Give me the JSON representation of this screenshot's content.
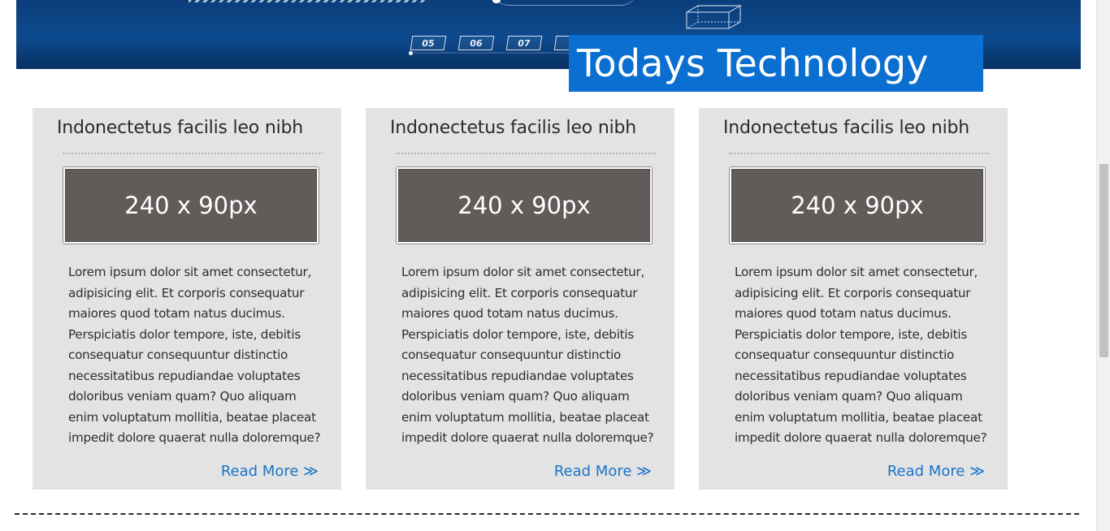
{
  "hero": {
    "slide_numbers": [
      "05",
      "06",
      "07",
      ""
    ]
  },
  "section": {
    "title": "Todays Technology"
  },
  "cards": [
    {
      "title": "Indonectetus facilis leo nibh",
      "image_placeholder": "240 x 90px",
      "body": "Lorem ipsum dolor sit amet consectetur, adipisicing elit. Et corporis consequatur maiores quod totam natus ducimus. Perspiciatis dolor tempore, iste, debitis consequatur consequuntur distinctio necessitatibus repudiandae voluptates doloribus veniam quam? Quo aliquam enim voluptatum mollitia, beatae placeat impedit dolore quaerat nulla doloremque?",
      "read_more": "Read More ≫"
    },
    {
      "title": "Indonectetus facilis leo nibh",
      "image_placeholder": "240 x 90px",
      "body": "Lorem ipsum dolor sit amet consectetur, adipisicing elit. Et corporis consequatur maiores quod totam natus ducimus. Perspiciatis dolor tempore, iste, debitis consequatur consequuntur distinctio necessitatibus repudiandae voluptates doloribus veniam quam? Quo aliquam enim voluptatum mollitia, beatae placeat impedit dolore quaerat nulla doloremque?",
      "read_more": "Read More ≫"
    },
    {
      "title": "Indonectetus facilis leo nibh",
      "image_placeholder": "240 x 90px",
      "body": "Lorem ipsum dolor sit amet consectetur, adipisicing elit. Et corporis consequatur maiores quod totam natus ducimus. Perspiciatis dolor tempore, iste, debitis consequatur consequuntur distinctio necessitatibus repudiandae voluptates doloribus veniam quam? Quo aliquam enim voluptatum mollitia, beatae placeat impedit dolore quaerat nulla doloremque?",
      "read_more": "Read More ≫"
    }
  ],
  "colors": {
    "title_bg": "#0a6fd1",
    "card_bg": "#e3e3e3",
    "link": "#1a73c8",
    "placeholder_bg": "#615c5a"
  }
}
